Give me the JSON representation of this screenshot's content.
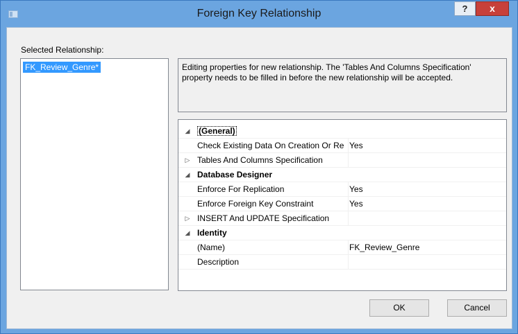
{
  "window": {
    "title": "Foreign Key Relationship",
    "help_label": "?",
    "close_label": "x"
  },
  "selected_relationship": {
    "label": "Selected Relationship:",
    "items": [
      "FK_Review_Genre*"
    ]
  },
  "info_text": "Editing properties for new relationship.  The 'Tables And Columns Specification' property needs to be filled in before the new relationship will be accepted.",
  "properties": [
    {
      "type": "category",
      "expander": "◢",
      "name": "(General)",
      "value": ""
    },
    {
      "type": "property",
      "expander": "",
      "name": "Check Existing Data On Creation Or Re-Enabling",
      "value": "Yes"
    },
    {
      "type": "property",
      "expander": "▷",
      "name": "Tables And Columns Specification",
      "value": ""
    },
    {
      "type": "category",
      "expander": "◢",
      "name": "Database Designer",
      "value": ""
    },
    {
      "type": "property",
      "expander": "",
      "name": "Enforce For Replication",
      "value": "Yes"
    },
    {
      "type": "property",
      "expander": "",
      "name": "Enforce Foreign Key Constraint",
      "value": "Yes"
    },
    {
      "type": "property",
      "expander": "▷",
      "name": "INSERT And UPDATE Specification",
      "value": ""
    },
    {
      "type": "category",
      "expander": "◢",
      "name": "Identity",
      "value": ""
    },
    {
      "type": "property",
      "expander": "",
      "name": "(Name)",
      "value": "FK_Review_Genre"
    },
    {
      "type": "property",
      "expander": "",
      "name": "Description",
      "value": ""
    }
  ],
  "buttons": {
    "ok_label": "OK",
    "cancel_label": "Cancel"
  }
}
